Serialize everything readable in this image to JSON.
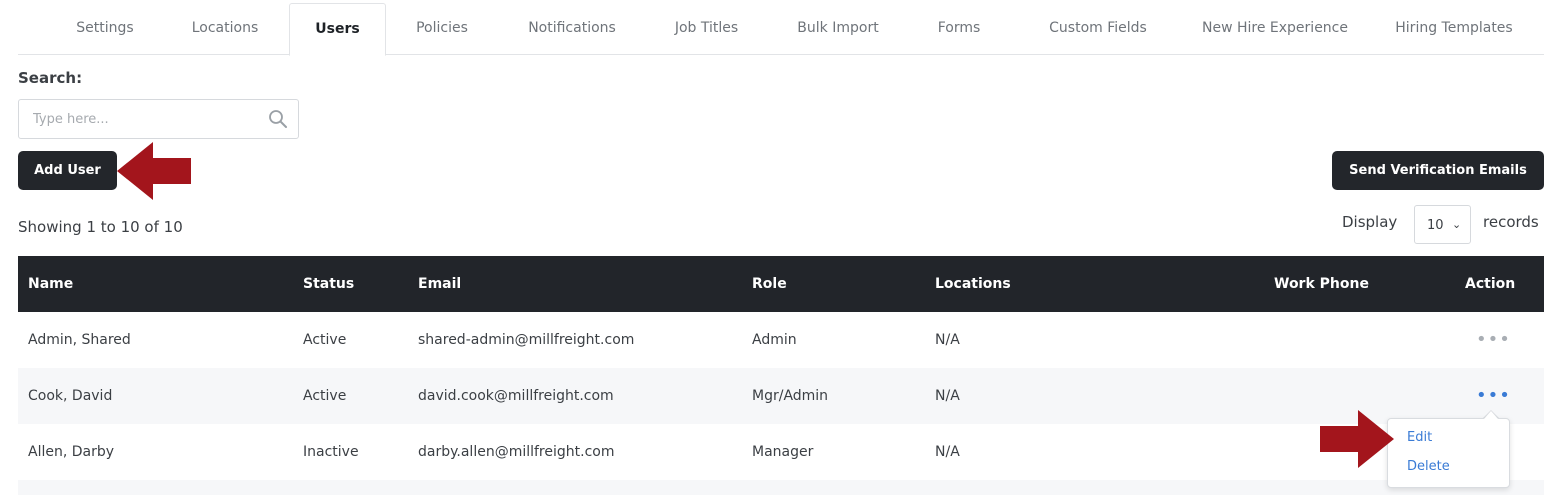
{
  "tabs": [
    {
      "label": "Settings"
    },
    {
      "label": "Locations"
    },
    {
      "label": "Users"
    },
    {
      "label": "Policies"
    },
    {
      "label": "Notifications"
    },
    {
      "label": "Job Titles"
    },
    {
      "label": "Bulk Import"
    },
    {
      "label": "Forms"
    },
    {
      "label": "Custom Fields"
    },
    {
      "label": "New Hire Experience"
    },
    {
      "label": "Hiring Templates"
    }
  ],
  "active_tab": "Users",
  "search": {
    "label": "Search:",
    "placeholder": "Type here...",
    "value": ""
  },
  "buttons": {
    "add_user": "Add User",
    "send_verification": "Send Verification Emails"
  },
  "pagination": {
    "showing": "Showing 1 to 10 of 10",
    "display_label": "Display",
    "per_page": "10",
    "records_label": "records"
  },
  "table": {
    "columns": [
      "Name",
      "Status",
      "Email",
      "Role",
      "Locations",
      "Work Phone",
      "Action"
    ],
    "rows": [
      {
        "name": "Admin, Shared",
        "status": "Active",
        "email": "shared-admin@millfreight.com",
        "role": "Admin",
        "locations": "N/A",
        "work_phone": "",
        "action": "•••"
      },
      {
        "name": "Cook, David",
        "status": "Active",
        "email": "david.cook@millfreight.com",
        "role": "Mgr/Admin",
        "locations": "N/A",
        "work_phone": "",
        "action": "•••"
      },
      {
        "name": "Allen, Darby",
        "status": "Inactive",
        "email": "darby.allen@millfreight.com",
        "role": "Manager",
        "locations": "N/A",
        "work_phone": "",
        "action": ""
      }
    ]
  },
  "action_menu": {
    "items": [
      "Edit",
      "Delete"
    ]
  },
  "icons": {
    "search": "search-icon",
    "select_chevron": "chevron-down-icon",
    "actions": "more-horizontal-icon",
    "annotation": "arrow-left-icon"
  },
  "colors": {
    "header_bg": "#22252a",
    "button_bg": "#23262b",
    "link": "#3a7bd5",
    "arrow": "#a3151c",
    "row_alt": "#f6f7f9"
  }
}
